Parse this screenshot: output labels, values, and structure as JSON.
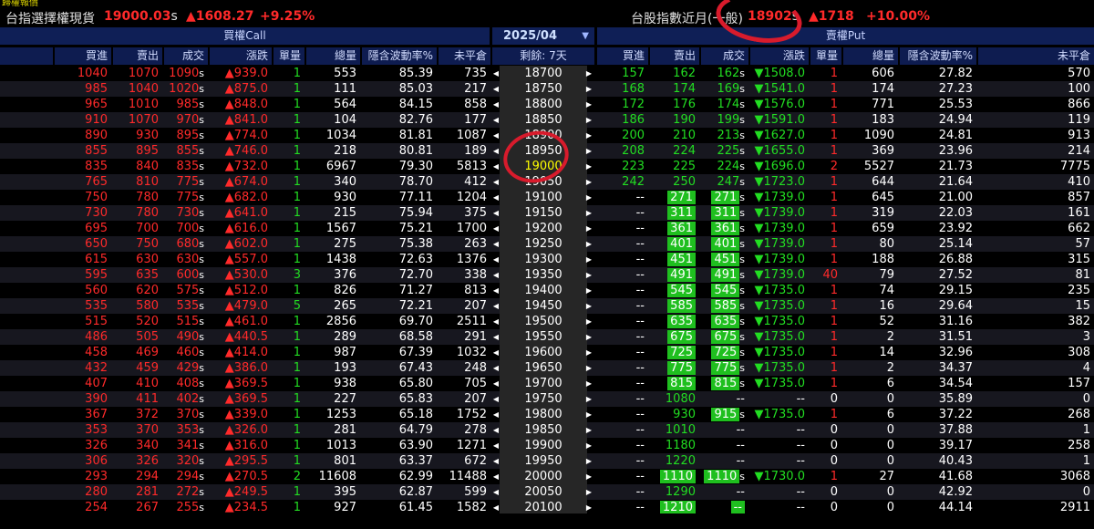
{
  "top_strip": "歸權報價",
  "info": {
    "left_label": "台指選擇權現貨",
    "left_price": "19000.03",
    "left_price_suffix": "s",
    "left_change": "▲1608.27",
    "left_pct": "+9.25%",
    "right_label": "台股指數近月(一般)",
    "right_price": "18902",
    "right_price_suffix": "s",
    "right_change": "▲1718",
    "right_pct": "+10.00%"
  },
  "groups": {
    "call": "買權Call",
    "month": "2025/04",
    "put": "賣權Put"
  },
  "headers": {
    "call": [
      "買進",
      "賣出",
      "成交",
      "漲跌",
      "單量",
      "總量",
      "隱含波動率%",
      "未平倉"
    ],
    "center": "剩餘: 7天",
    "put": [
      "買進",
      "賣出",
      "成交",
      "漲跌",
      "單量",
      "總量",
      "隱含波動率%",
      "未平倉"
    ]
  },
  "rows": [
    {
      "cb": "1040",
      "cs": "1070",
      "cl": "1090",
      "cc": "▲939.0",
      "cq": "1",
      "cv": "553",
      "civ": "85.39",
      "coi": "735",
      "k": "18700",
      "pb": "157",
      "ps": "162",
      "pl": "162",
      "pc": "▼1508.0",
      "pq": "1",
      "pv": "606",
      "piv": "27.82",
      "poi": "570"
    },
    {
      "cb": "985",
      "cs": "1040",
      "cl": "1020",
      "cc": "▲875.0",
      "cq": "1",
      "cv": "111",
      "civ": "85.03",
      "coi": "217",
      "k": "18750",
      "pb": "168",
      "ps": "174",
      "pl": "169",
      "pc": "▼1541.0",
      "pq": "1",
      "pv": "174",
      "piv": "27.23",
      "poi": "100"
    },
    {
      "cb": "965",
      "cs": "1010",
      "cl": "985",
      "cc": "▲848.0",
      "cq": "1",
      "cv": "564",
      "civ": "84.15",
      "coi": "858",
      "k": "18800",
      "pb": "172",
      "ps": "176",
      "pl": "174",
      "pc": "▼1576.0",
      "pq": "1",
      "pv": "771",
      "piv": "25.53",
      "poi": "866"
    },
    {
      "cb": "910",
      "cs": "1070",
      "cl": "970",
      "cc": "▲841.0",
      "cq": "1",
      "cv": "104",
      "civ": "82.76",
      "coi": "177",
      "k": "18850",
      "pb": "186",
      "ps": "190",
      "pl": "199",
      "pc": "▼1591.0",
      "pq": "1",
      "pv": "183",
      "piv": "24.94",
      "poi": "119"
    },
    {
      "cb": "890",
      "cs": "930",
      "cl": "895",
      "cc": "▲774.0",
      "cq": "1",
      "cv": "1034",
      "civ": "81.81",
      "coi": "1087",
      "k": "18900",
      "pb": "200",
      "ps": "210",
      "pl": "213",
      "pc": "▼1627.0",
      "pq": "1",
      "pv": "1090",
      "piv": "24.81",
      "poi": "913"
    },
    {
      "cb": "855",
      "cs": "895",
      "cl": "855",
      "cc": "▲746.0",
      "cq": "1",
      "cv": "218",
      "civ": "80.81",
      "coi": "189",
      "k": "18950",
      "pb": "208",
      "ps": "224",
      "pl": "225",
      "pc": "▼1655.0",
      "pq": "1",
      "pv": "369",
      "piv": "23.96",
      "poi": "214"
    },
    {
      "cb": "835",
      "cs": "840",
      "cl": "835",
      "cc": "▲732.0",
      "cq": "1",
      "cv": "6967",
      "civ": "79.30",
      "coi": "5813",
      "k": "19000",
      "atm": true,
      "pb": "223",
      "ps": "225",
      "pl": "224",
      "pc": "▼1696.0",
      "pq": "2",
      "pv": "5527",
      "piv": "21.73",
      "poi": "7775"
    },
    {
      "cb": "765",
      "cs": "810",
      "cl": "775",
      "cc": "▲674.0",
      "cq": "1",
      "cv": "340",
      "civ": "78.70",
      "coi": "412",
      "k": "19050",
      "pb": "242",
      "ps": "250",
      "pl": "247",
      "pc": "▼1723.0",
      "pq": "1",
      "pv": "644",
      "piv": "21.64",
      "poi": "410"
    },
    {
      "cb": "750",
      "cs": "780",
      "cl": "775",
      "cc": "▲682.0",
      "cq": "1",
      "cv": "930",
      "civ": "77.11",
      "coi": "1204",
      "k": "19100",
      "pb": "--",
      "ps": "271",
      "pl": "271",
      "pc": "▼1739.0",
      "pq": "1",
      "pv": "645",
      "piv": "21.00",
      "poi": "857",
      "hl": true
    },
    {
      "cb": "730",
      "cs": "780",
      "cl": "730",
      "cc": "▲641.0",
      "cq": "1",
      "cv": "215",
      "civ": "75.94",
      "coi": "375",
      "k": "19150",
      "pb": "--",
      "ps": "311",
      "pl": "311",
      "pc": "▼1739.0",
      "pq": "1",
      "pv": "319",
      "piv": "22.03",
      "poi": "161",
      "hl": true
    },
    {
      "cb": "695",
      "cs": "700",
      "cl": "700",
      "cc": "▲616.0",
      "cq": "1",
      "cv": "1567",
      "civ": "75.21",
      "coi": "1700",
      "k": "19200",
      "pb": "--",
      "ps": "361",
      "pl": "361",
      "pc": "▼1739.0",
      "pq": "1",
      "pv": "659",
      "piv": "23.92",
      "poi": "662",
      "hl": true
    },
    {
      "cb": "650",
      "cs": "750",
      "cl": "680",
      "cc": "▲602.0",
      "cq": "1",
      "cv": "275",
      "civ": "75.38",
      "coi": "263",
      "k": "19250",
      "pb": "--",
      "ps": "401",
      "pl": "401",
      "pc": "▼1739.0",
      "pq": "1",
      "pv": "80",
      "piv": "25.14",
      "poi": "57",
      "hl": true
    },
    {
      "cb": "615",
      "cs": "630",
      "cl": "630",
      "cc": "▲557.0",
      "cq": "1",
      "cv": "1438",
      "civ": "72.63",
      "coi": "1376",
      "k": "19300",
      "pb": "--",
      "ps": "451",
      "pl": "451",
      "pc": "▼1739.0",
      "pq": "1",
      "pv": "188",
      "piv": "26.88",
      "poi": "315",
      "hl": true
    },
    {
      "cb": "595",
      "cs": "635",
      "cl": "600",
      "cc": "▲530.0",
      "cq": "3",
      "cv": "376",
      "civ": "72.70",
      "coi": "338",
      "k": "19350",
      "pb": "--",
      "ps": "491",
      "pl": "491",
      "pc": "▼1739.0",
      "pq": "40",
      "pv": "79",
      "piv": "27.52",
      "poi": "81",
      "hl": true
    },
    {
      "cb": "560",
      "cs": "620",
      "cl": "575",
      "cc": "▲512.0",
      "cq": "1",
      "cv": "826",
      "civ": "71.27",
      "coi": "813",
      "k": "19400",
      "pb": "--",
      "ps": "545",
      "pl": "545",
      "pc": "▼1735.0",
      "pq": "1",
      "pv": "74",
      "piv": "29.15",
      "poi": "235",
      "hl": true
    },
    {
      "cb": "535",
      "cs": "580",
      "cl": "535",
      "cc": "▲479.0",
      "cq": "5",
      "cv": "265",
      "civ": "72.21",
      "coi": "207",
      "k": "19450",
      "pb": "--",
      "ps": "585",
      "pl": "585",
      "pc": "▼1735.0",
      "pq": "1",
      "pv": "16",
      "piv": "29.64",
      "poi": "15",
      "hl": true
    },
    {
      "cb": "515",
      "cs": "520",
      "cl": "515",
      "cc": "▲461.0",
      "cq": "1",
      "cv": "2856",
      "civ": "69.70",
      "coi": "2511",
      "k": "19500",
      "pb": "--",
      "ps": "635",
      "pl": "635",
      "pc": "▼1735.0",
      "pq": "1",
      "pv": "52",
      "piv": "31.16",
      "poi": "382",
      "hl": true
    },
    {
      "cb": "486",
      "cs": "505",
      "cl": "490",
      "cc": "▲440.5",
      "cq": "1",
      "cv": "289",
      "civ": "68.58",
      "coi": "291",
      "k": "19550",
      "pb": "--",
      "ps": "675",
      "pl": "675",
      "pc": "▼1735.0",
      "pq": "1",
      "pv": "2",
      "piv": "31.51",
      "poi": "3",
      "hl": true
    },
    {
      "cb": "458",
      "cs": "469",
      "cl": "460",
      "cc": "▲414.0",
      "cq": "1",
      "cv": "987",
      "civ": "67.39",
      "coi": "1032",
      "k": "19600",
      "pb": "--",
      "ps": "725",
      "pl": "725",
      "pc": "▼1735.0",
      "pq": "1",
      "pv": "14",
      "piv": "32.96",
      "poi": "308",
      "hl": true
    },
    {
      "cb": "432",
      "cs": "459",
      "cl": "429",
      "cc": "▲386.0",
      "cq": "1",
      "cv": "193",
      "civ": "67.43",
      "coi": "248",
      "k": "19650",
      "pb": "--",
      "ps": "775",
      "pl": "775",
      "pc": "▼1735.0",
      "pq": "1",
      "pv": "2",
      "piv": "34.37",
      "poi": "4",
      "hl": true
    },
    {
      "cb": "407",
      "cs": "410",
      "cl": "408",
      "cc": "▲369.5",
      "cq": "1",
      "cv": "938",
      "civ": "65.80",
      "coi": "705",
      "k": "19700",
      "pb": "--",
      "ps": "815",
      "pl": "815",
      "pc": "▼1735.0",
      "pq": "1",
      "pv": "6",
      "piv": "34.54",
      "poi": "157",
      "hl": true
    },
    {
      "cb": "390",
      "cs": "411",
      "cl": "402",
      "cc": "▲369.5",
      "cq": "1",
      "cv": "227",
      "civ": "65.83",
      "coi": "207",
      "k": "19750",
      "pb": "--",
      "ps": "1080",
      "pl": "--",
      "pc": "--",
      "pq": "0",
      "pv": "0",
      "piv": "35.89",
      "poi": "0",
      "psg": true
    },
    {
      "cb": "367",
      "cs": "372",
      "cl": "370",
      "cc": "▲339.0",
      "cq": "1",
      "cv": "1253",
      "civ": "65.18",
      "coi": "1752",
      "k": "19800",
      "pb": "--",
      "ps": "930",
      "pl": "915",
      "pc": "▼1735.0",
      "pq": "1",
      "pv": "6",
      "piv": "37.22",
      "poi": "268",
      "psg": true,
      "plhl": true
    },
    {
      "cb": "353",
      "cs": "370",
      "cl": "353",
      "cc": "▲326.0",
      "cq": "1",
      "cv": "281",
      "civ": "64.79",
      "coi": "278",
      "k": "19850",
      "pb": "--",
      "ps": "1010",
      "pl": "--",
      "pc": "--",
      "pq": "0",
      "pv": "0",
      "piv": "37.88",
      "poi": "1",
      "psg": true
    },
    {
      "cb": "326",
      "cs": "340",
      "cl": "341",
      "cc": "▲316.0",
      "cq": "1",
      "cv": "1013",
      "civ": "63.90",
      "coi": "1271",
      "k": "19900",
      "pb": "--",
      "ps": "1180",
      "pl": "--",
      "pc": "--",
      "pq": "0",
      "pv": "0",
      "piv": "39.17",
      "poi": "258",
      "psg": true
    },
    {
      "cb": "306",
      "cs": "326",
      "cl": "320",
      "cc": "▲295.5",
      "cq": "1",
      "cv": "801",
      "civ": "63.37",
      "coi": "672",
      "k": "19950",
      "pb": "--",
      "ps": "1220",
      "pl": "--",
      "pc": "--",
      "pq": "0",
      "pv": "0",
      "piv": "40.43",
      "poi": "1",
      "psg": true
    },
    {
      "cb": "293",
      "cs": "294",
      "cl": "294",
      "cc": "▲270.5",
      "cq": "2",
      "cv": "11608",
      "civ": "62.99",
      "coi": "11488",
      "k": "20000",
      "pb": "--",
      "ps": "1110",
      "pl": "1110",
      "pc": "▼1730.0",
      "pq": "1",
      "pv": "27",
      "piv": "41.68",
      "poi": "3068",
      "hl": true
    },
    {
      "cb": "280",
      "cs": "281",
      "cl": "272",
      "cc": "▲249.5",
      "cq": "1",
      "cv": "395",
      "civ": "62.87",
      "coi": "599",
      "k": "20050",
      "pb": "--",
      "ps": "1290",
      "pl": "--",
      "pc": "--",
      "pq": "0",
      "pv": "0",
      "piv": "42.92",
      "poi": "0",
      "psg": true
    },
    {
      "cb": "254",
      "cs": "267",
      "cl": "255",
      "cc": "▲234.5",
      "cq": "1",
      "cv": "927",
      "civ": "61.45",
      "coi": "1582",
      "k": "20100",
      "pb": "--",
      "ps": "1210",
      "pl": "--",
      "pc": "--",
      "pq": "0",
      "pv": "0",
      "piv": "44.14",
      "poi": "2911",
      "hl": true
    }
  ],
  "colors": {
    "up": "#ff2a2a",
    "down": "#22dd22",
    "header_bg": "#0e1c50",
    "atm": "#ffff00",
    "annotation": "#d81b2c"
  }
}
